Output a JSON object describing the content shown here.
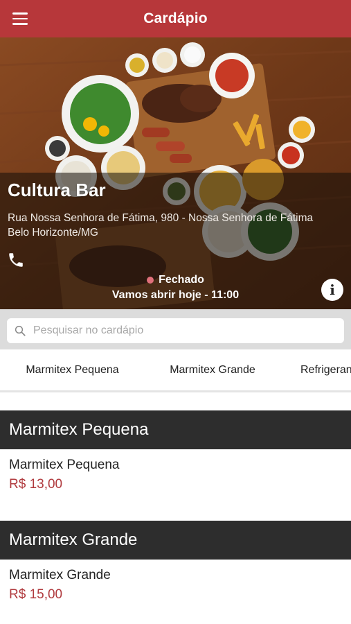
{
  "header": {
    "title": "Cardápio",
    "menu_icon": "hamburger-menu-icon"
  },
  "store": {
    "name": "Cultura Bar",
    "address_line1": "Rua Nossa Senhora de Fátima, 980 - Nossa Senhora de Fátima",
    "address_line2": "Belo Horizonte/MG",
    "status": "Fechado",
    "status_detail": "Vamos abrir hoje - 11:00",
    "info_label": "i"
  },
  "search": {
    "placeholder": "Pesquisar no cardápio",
    "value": ""
  },
  "tabs": [
    {
      "label": "Marmitex Pequena",
      "active": true
    },
    {
      "label": "Marmitex Grande",
      "active": false
    },
    {
      "label": "Refrigerantes",
      "active": false
    }
  ],
  "sections": [
    {
      "title": "Marmitex Pequena",
      "items": [
        {
          "name": "Marmitex Pequena",
          "price": "R$ 13,00"
        }
      ]
    },
    {
      "title": "Marmitex Grande",
      "items": [
        {
          "name": "Marmitex Grande",
          "price": "R$ 15,00"
        }
      ]
    }
  ],
  "colors": {
    "brand": "#b7373a",
    "section_header": "#2d2d2d",
    "price": "#b03a3e",
    "tab_indicator": "#4a2a6e",
    "status_dot": "#e0707a"
  }
}
